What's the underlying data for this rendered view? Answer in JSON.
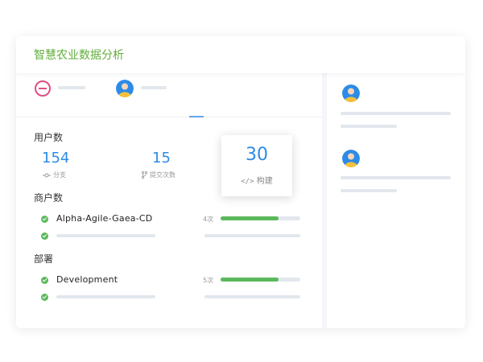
{
  "header": {
    "title": "智慧农业数据分析"
  },
  "users_section": {
    "title": "用户数",
    "stats": [
      {
        "value": "154",
        "caption": "分支",
        "icon": "commit-icon"
      },
      {
        "value": "15",
        "caption": "提交次数",
        "icon": "branch-icon"
      }
    ],
    "popup": {
      "value": "30",
      "caption": "构建",
      "icon": "code-icon"
    }
  },
  "merchants_section": {
    "title": "商户数",
    "items": [
      {
        "name": "Alpha-Agile-Gaea-CD",
        "count": "4次",
        "progress": 0.73
      },
      {
        "name": "",
        "count": "",
        "progress": null
      }
    ]
  },
  "deploy_section": {
    "title": "部署",
    "items": [
      {
        "name": "Development",
        "count": "5次",
        "progress": 0.73
      },
      {
        "name": "",
        "count": "",
        "progress": null
      }
    ]
  },
  "colors": {
    "accent_green": "#62ad3c",
    "number_blue": "#2d8be8",
    "progress_green": "#5cb85c",
    "stop_pink": "#e24d83"
  }
}
